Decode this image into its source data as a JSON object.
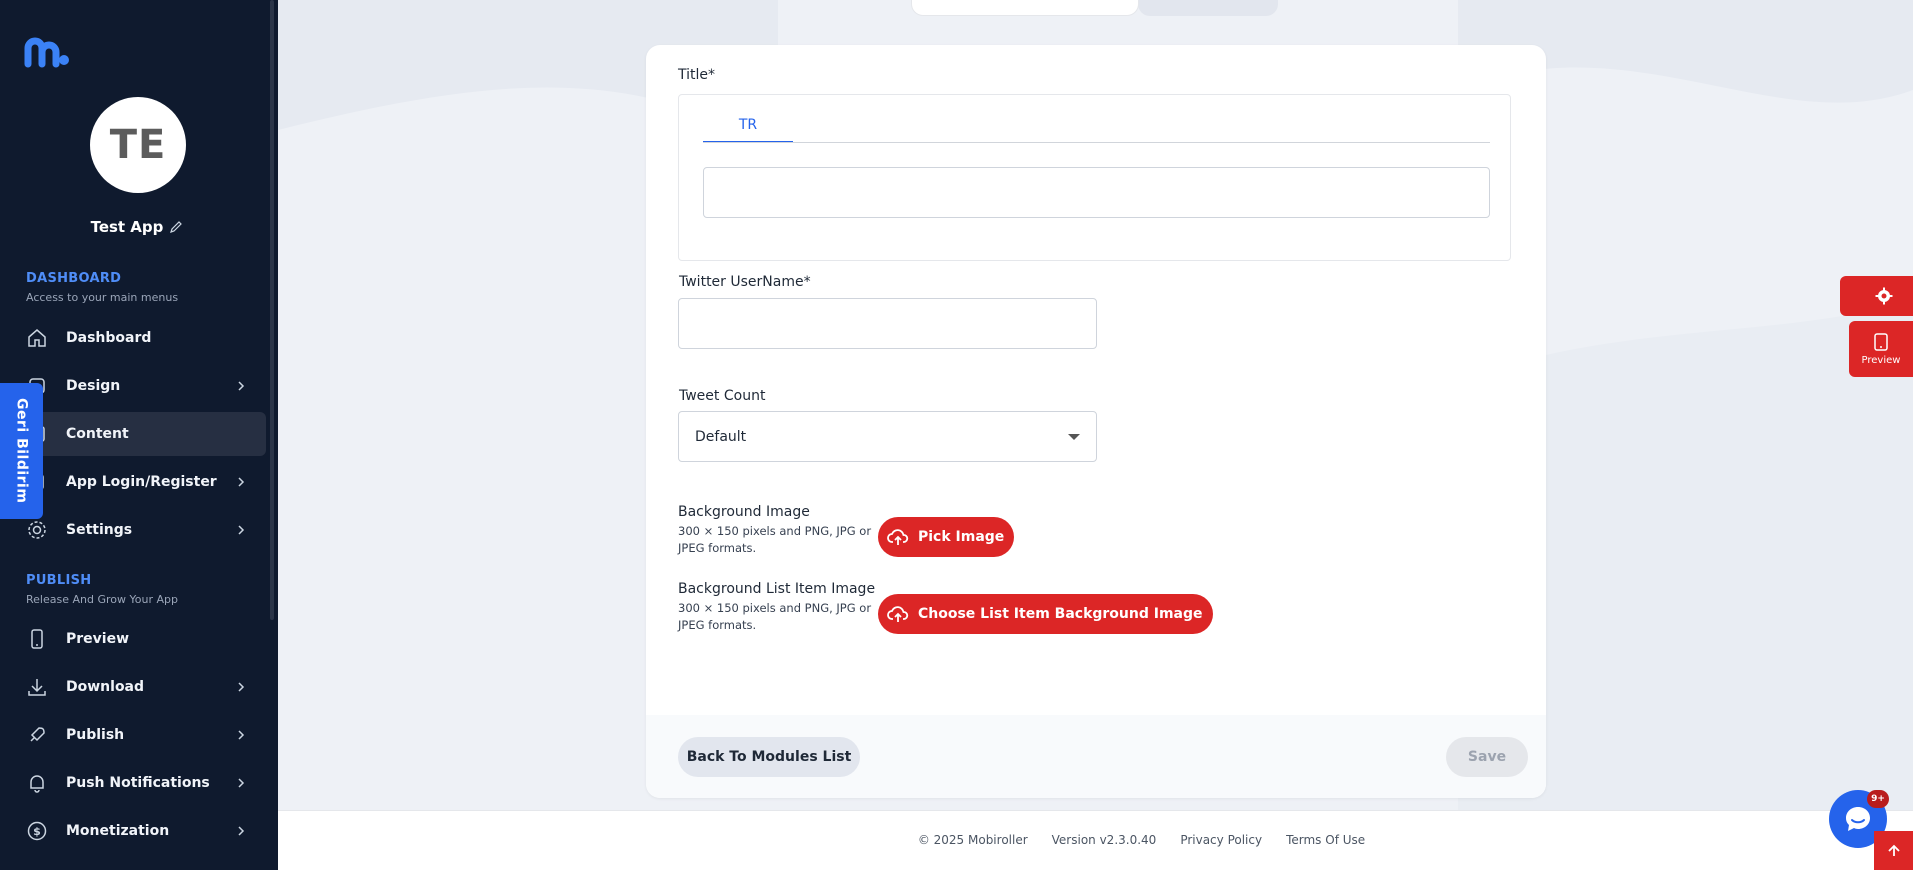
{
  "sidebar": {
    "avatar_initials": "TE",
    "app_name": "Test App",
    "sections": {
      "dashboard": {
        "title": "DASHBOARD",
        "subtitle": "Access to your main menus"
      },
      "publish": {
        "title": "PUBLISH",
        "subtitle": "Release And Grow Your App"
      }
    },
    "items": [
      {
        "label": "Dashboard",
        "icon": "home-icon"
      },
      {
        "label": "Design",
        "icon": "palette-icon"
      },
      {
        "label": "Content",
        "icon": "content-icon"
      },
      {
        "label": "App Login/Register",
        "icon": "login-icon"
      },
      {
        "label": "Settings",
        "icon": "gear-icon"
      },
      {
        "label": "Preview",
        "icon": "phone-icon"
      },
      {
        "label": "Download",
        "icon": "download-icon"
      },
      {
        "label": "Publish",
        "icon": "rocket-icon"
      },
      {
        "label": "Push Notifications",
        "icon": "bell-icon"
      },
      {
        "label": "Monetization",
        "icon": "dollar-icon"
      }
    ],
    "feedback_label": "Geri Bildirim"
  },
  "form": {
    "title_label": "Title*",
    "tab_tr": "TR",
    "title_value": "",
    "twitter_label": "Twitter UserName*",
    "twitter_value": "",
    "tweet_count_label": "Tweet Count",
    "tweet_count_value": "Default",
    "bg_image_label": "Background Image",
    "bg_image_desc": "300 × 150 pixels and PNG, JPG or JPEG formats.",
    "bg_image_button": "Pick Image",
    "bg_list_label": "Background List Item Image",
    "bg_list_desc": "300 × 150 pixels and PNG, JPG or JPEG formats.",
    "bg_list_button": "Choose List Item Background Image",
    "back_button": "Back To Modules List",
    "save_button": "Save"
  },
  "footer": {
    "copyright": "© 2025 Mobiroller",
    "version": "Version v2.3.0.40",
    "privacy": "Privacy Policy",
    "terms": "Terms Of Use"
  },
  "floating": {
    "preview_label": "Preview",
    "chat_badge": "9+"
  },
  "colors": {
    "sidebar_bg": "#0f1a2e",
    "accent_blue": "#2563eb",
    "accent_red": "#dc2626"
  }
}
